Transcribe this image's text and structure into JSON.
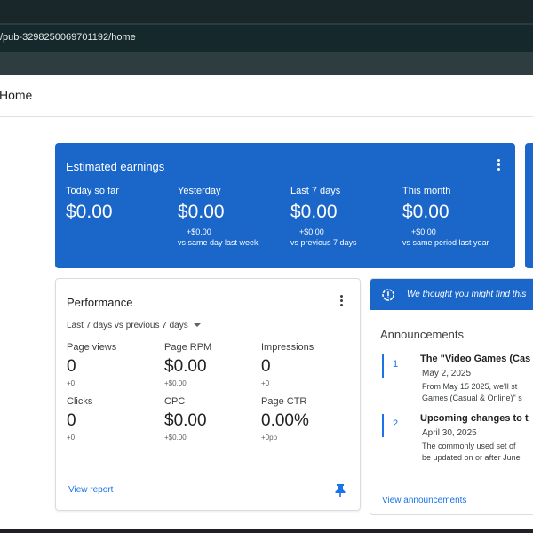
{
  "browser": {
    "url": "/pub-3298250069701192/home"
  },
  "header": {
    "title": "Home"
  },
  "earnings": {
    "title": "Estimated earnings",
    "metrics": [
      {
        "label": "Today so far",
        "value": "$0.00",
        "delta": "",
        "comparison": ""
      },
      {
        "label": "Yesterday",
        "value": "$0.00",
        "delta": "+$0.00",
        "comparison": "vs same day last week"
      },
      {
        "label": "Last 7 days",
        "value": "$0.00",
        "delta": "+$0.00",
        "comparison": "vs previous 7 days"
      },
      {
        "label": "This month",
        "value": "$0.00",
        "delta": "+$0.00",
        "comparison": "vs same period last year"
      }
    ]
  },
  "performance": {
    "title": "Performance",
    "range": "Last 7 days vs previous 7 days",
    "stats": [
      {
        "label": "Page views",
        "value": "0",
        "sub": "+0"
      },
      {
        "label": "Page RPM",
        "value": "$0.00",
        "sub": "+$0.00"
      },
      {
        "label": "Impressions",
        "value": "0",
        "sub": "+0"
      },
      {
        "label": "Clicks",
        "value": "0",
        "sub": "+0"
      },
      {
        "label": "CPC",
        "value": "$0.00",
        "sub": "+$0.00"
      },
      {
        "label": "Page CTR",
        "value": "0.00%",
        "sub": "+0pp"
      }
    ],
    "view_report": "View report"
  },
  "announcements": {
    "banner": "We thought you might find this",
    "heading": "Announcements",
    "items": [
      {
        "num": "1",
        "title": "The \"Video Games (Cas",
        "date": "May 2, 2025",
        "desc1": "From May 15 2025, we'll st",
        "desc2": "Games (Casual & Online)\" s"
      },
      {
        "num": "2",
        "title": "Upcoming changes to t",
        "date": "April 30, 2025",
        "desc1": "The commonly used set of",
        "desc2": "be updated on or after June"
      }
    ],
    "view_all": "View announcements"
  },
  "colors": {
    "primary": "#1a66c9",
    "link": "#1a73e8"
  }
}
